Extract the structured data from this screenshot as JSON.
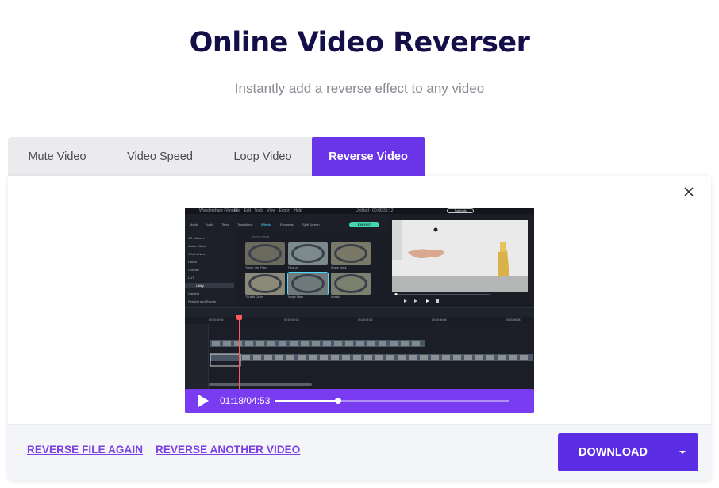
{
  "page": {
    "title": "Online Video Reverser",
    "subtitle": "Instantly add a reverse effect to any video"
  },
  "tabs": [
    {
      "label": "Mute Video",
      "active": false
    },
    {
      "label": "Video Speed",
      "active": false
    },
    {
      "label": "Loop Video",
      "active": false
    },
    {
      "label": "Reverse Video",
      "active": true
    }
  ],
  "player": {
    "time": "01:18/04:53",
    "progress": 0.27
  },
  "footer": {
    "reverse_again_label": "REVERSE FILE AGAIN",
    "reverse_another_label": "REVERSE ANOTHER VIDEO",
    "download_label": "DOWNLOAD"
  },
  "app_preview": {
    "app_name": "Wondershare Filmora",
    "menu": "File Edit Tools View Export Help",
    "project": "Untitled : 00:00:35:12",
    "tutorials": "Tutorials",
    "tools": [
      "Media",
      "Audio",
      "Titles",
      "Transitions",
      "Effects",
      "Elements",
      "Split Screen"
    ],
    "export_label": "EXPORT",
    "sidebar": [
      "AR stickers",
      "Audio effects",
      "What's New",
      "Filters",
      "Overlay",
      "LUT",
      "Utility",
      "Gaming",
      "Festival and Events"
    ],
    "sidebar_active": "Utility",
    "search_placeholder": "Search effects",
    "thumbs": [
      "Travel_Life_Filter",
      "Face-off",
      "Shape Mask",
      "Tilt-shift Circle",
      "Image Mask",
      "Mosaic"
    ],
    "ruler": [
      "00:00:00:00",
      "00:00:02:02",
      "00:00:04:04",
      "00:00:06:06",
      "00:00:08:08"
    ]
  },
  "colors": {
    "accent": "#6a35e8",
    "download_bg": "#5b2ee6",
    "link": "#7b3fe4",
    "title": "#140f49",
    "player_bar": "#7a3cf0"
  }
}
